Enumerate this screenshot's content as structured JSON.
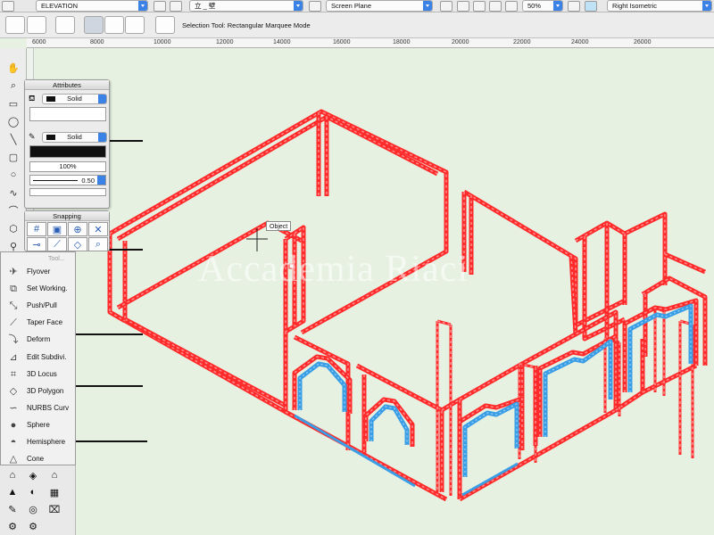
{
  "topbar": {
    "class_label": "ELEVATION",
    "layer_label": "立 _ 壁",
    "plane_label": "Screen Plane",
    "zoom_label": "50%",
    "view_label": "Right Isometric"
  },
  "modebar": {
    "mode_text": "Selection Tool: Rectangular Marquee Mode"
  },
  "ruler": {
    "labels": [
      "6000",
      "8000",
      "10000",
      "12000",
      "14000",
      "16000",
      "18000",
      "20000",
      "22000",
      "24000",
      "26000"
    ]
  },
  "attributes": {
    "title": "Attributes",
    "fill_style": "Solid",
    "pen_style": "Solid",
    "opacity": "100%",
    "line_weight": "0.50"
  },
  "snapping": {
    "title": "Snapping"
  },
  "flyout": {
    "title": "Tool...",
    "items": [
      {
        "label": "Flyover",
        "icon": "flyover-icon"
      },
      {
        "label": "Set Working.",
        "icon": "set-working-plane-icon"
      },
      {
        "label": "Push/Pull",
        "icon": "push-pull-icon"
      },
      {
        "label": "Taper Face",
        "icon": "taper-face-icon"
      },
      {
        "label": "Deform",
        "icon": "deform-icon"
      },
      {
        "label": "Edit Subdivi.",
        "icon": "edit-subdivision-icon"
      },
      {
        "label": "3D Locus",
        "icon": "3d-locus-icon"
      },
      {
        "label": "3D Polygon",
        "icon": "3d-polygon-icon"
      },
      {
        "label": "NURBS Curv",
        "icon": "nurbs-curve-icon"
      },
      {
        "label": "Sphere",
        "icon": "sphere-icon"
      },
      {
        "label": "Hemisphere",
        "icon": "hemisphere-icon"
      },
      {
        "label": "Cone",
        "icon": "cone-icon"
      }
    ]
  },
  "canvas": {
    "tooltip": "Object",
    "watermark": "Accademia Riaci",
    "colors": {
      "wire": "#ff2a2a",
      "wire_light": "#ff8c8c",
      "arch_fill": "#3a9ee6",
      "background": "#e6f1e2"
    }
  }
}
